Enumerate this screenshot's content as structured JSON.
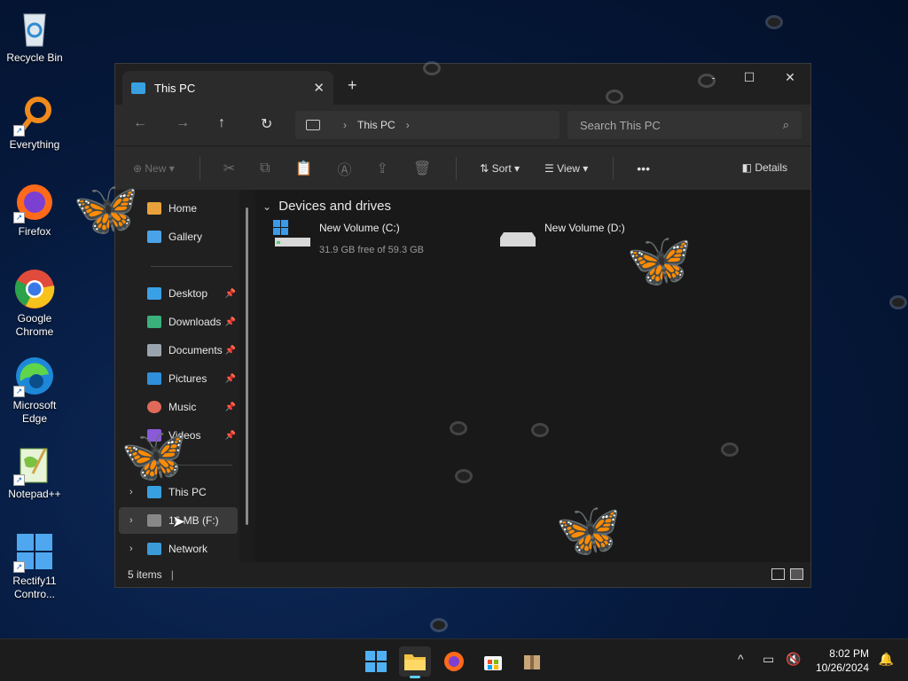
{
  "desktop": {
    "icons": [
      {
        "label": "Recycle Bin",
        "icon": "recycle-bin-icon"
      },
      {
        "label": "Everything",
        "icon": "everything-search-icon"
      },
      {
        "label": "Firefox",
        "icon": "firefox-icon"
      },
      {
        "label": "Google Chrome",
        "icon": "chrome-icon"
      },
      {
        "label": "Microsoft Edge",
        "icon": "edge-icon"
      },
      {
        "label": "Notepad++",
        "icon": "notepad-plus-plus-icon"
      },
      {
        "label": "Rectify11 Contro...",
        "icon": "control-panel-icon"
      }
    ]
  },
  "explorer": {
    "tab_title": "This PC",
    "new_tab": "+",
    "address": {
      "location": "This PC"
    },
    "search": {
      "placeholder": "Search This PC"
    },
    "commands": {
      "new": "New",
      "sort": "Sort",
      "view": "View",
      "more": "•••",
      "details": "Details"
    },
    "nav": {
      "home": "Home",
      "gallery": "Gallery",
      "desktop": "Desktop",
      "downloads": "Downloads",
      "documents": "Documents",
      "pictures": "Pictures",
      "music": "Music",
      "videos": "Videos",
      "this_pc": "This PC",
      "usb": "16 MB (F:)",
      "network": "Network"
    },
    "group_header": "Devices and drives",
    "drives": [
      {
        "name": "New Volume (C:)",
        "space": "31.9 GB free of 59.3 GB"
      },
      {
        "name": "New Volume (D:)",
        "space": ""
      }
    ],
    "status": {
      "items": "5 items"
    }
  },
  "taskbar": {
    "time": "8:02 PM",
    "date": "10/26/2024",
    "tray_chevron": "^"
  }
}
